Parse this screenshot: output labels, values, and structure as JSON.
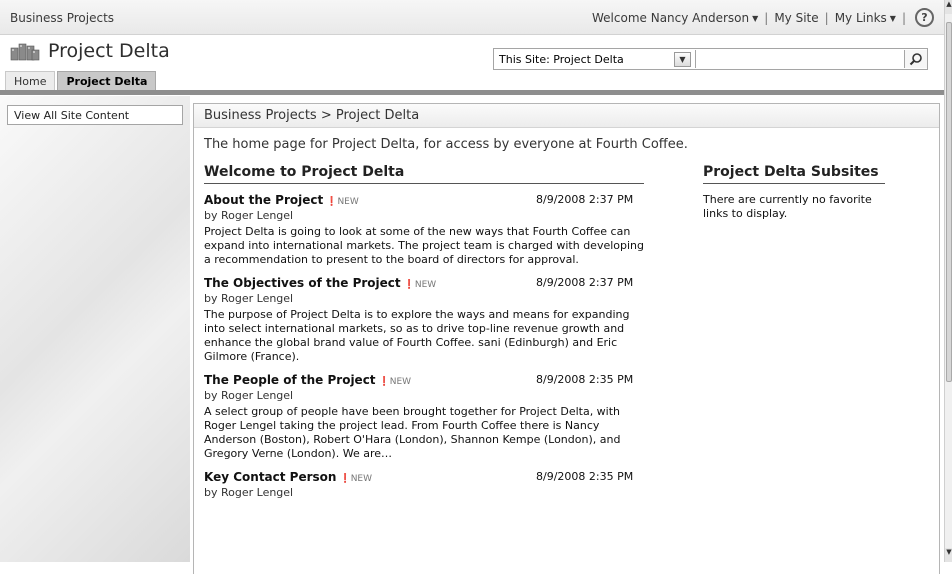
{
  "topbar": {
    "site_name": "Business Projects",
    "welcome": "Welcome Nancy Anderson",
    "my_site": "My Site",
    "my_links": "My Links",
    "sep": "|",
    "help_glyph": "?"
  },
  "header": {
    "title": "Project Delta",
    "search": {
      "scope_value": "This Site: Project Delta",
      "input_value": "",
      "placeholder": ""
    },
    "tabs": [
      {
        "label": "Home"
      },
      {
        "label": "Project Delta"
      }
    ]
  },
  "leftnav": {
    "view_all": "View All Site Content"
  },
  "content": {
    "breadcrumb": "Business Projects > Project Delta",
    "description": "The home page for Project Delta, for access by everyone at Fourth Coffee.",
    "main_title": "Welcome to Project Delta",
    "new_label": "NEW",
    "posts": [
      {
        "title": "About the Project",
        "date": "8/9/2008 2:37 PM",
        "author": "by Roger Lengel",
        "body": "Project Delta is going to look at some of the new ways that Fourth Coffee can expand into international markets. The project team is charged with developing a recommendation to present to the board of directors for approval."
      },
      {
        "title": "The Objectives of the Project",
        "date": "8/9/2008 2:37 PM",
        "author": "by Roger Lengel",
        "body": "The purpose of Project Delta is to explore the ways and means for expanding into select international markets, so as to drive top-line revenue growth and enhance the global brand value of Fourth Coffee. sani (Edinburgh) and Eric Gilmore (France)."
      },
      {
        "title": "The People of the Project",
        "date": "8/9/2008 2:35 PM",
        "author": "by Roger Lengel",
        "body": "A select group of people have been brought together for Project Delta, with Roger Lengel taking the project lead. From Fourth Coffee there is Nancy Anderson (Boston), Robert O'Hara (London), Shannon Kempe (London), and Gregory Verne (London). We are…"
      },
      {
        "title": "Key Contact Person",
        "date": "8/9/2008 2:35 PM",
        "author": "by Roger Lengel",
        "body": ""
      }
    ],
    "side_title": "Project Delta Subsites",
    "side_text": "There are currently no favorite links to display."
  },
  "colors": {
    "tab_active": "#c8c8c8",
    "tab_line": "#8e8e8e",
    "new_flag": "#777777"
  }
}
